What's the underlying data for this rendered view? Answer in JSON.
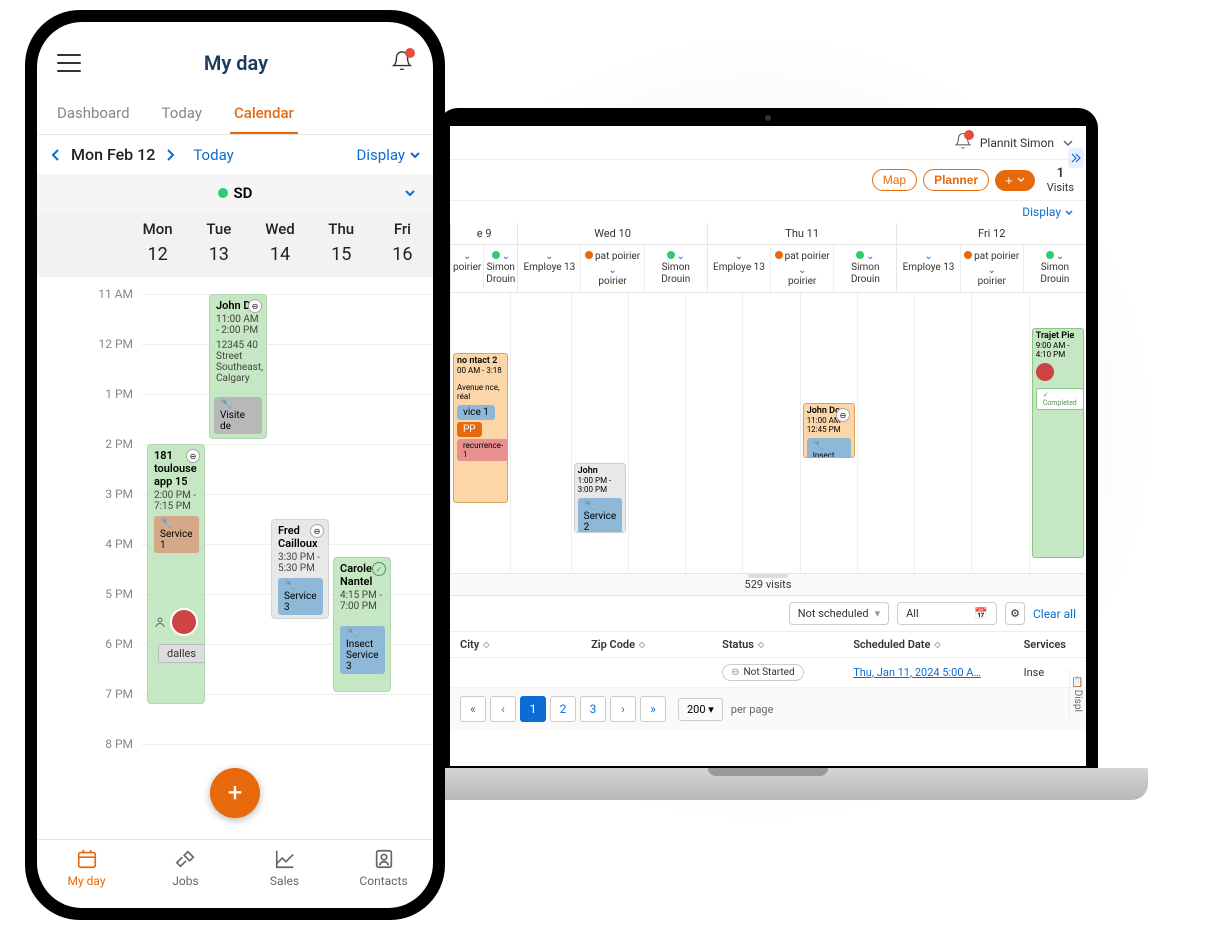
{
  "phone": {
    "title": "My day",
    "tabs": {
      "dashboard": "Dashboard",
      "today": "Today",
      "calendar": "Calendar"
    },
    "date": "Mon Feb 12",
    "today_link": "Today",
    "display_link": "Display",
    "employee_label": "SD",
    "weekdays": [
      {
        "dow": "Mon",
        "num": "12"
      },
      {
        "dow": "Tue",
        "num": "13"
      },
      {
        "dow": "Wed",
        "num": "14"
      },
      {
        "dow": "Thu",
        "num": "15"
      },
      {
        "dow": "Fri",
        "num": "16"
      }
    ],
    "hours": [
      "11 AM",
      "12 PM",
      "1 PM",
      "2 PM",
      "3 PM",
      "4 PM",
      "5 PM",
      "6 PM",
      "7 PM",
      "8 PM"
    ],
    "events": {
      "johndoe": {
        "title": "John Do",
        "time": "11:00 AM - 2:00 PM",
        "loc1": "12345 40 Street",
        "loc2": "Southeast, Calgary",
        "svc": "Visite de"
      },
      "toulouse": {
        "title": "181 toulouse app 15",
        "time": "2:00 PM - 7:15 PM",
        "svc": "Service 1",
        "tag": "dalles"
      },
      "fred": {
        "title": "Fred Cailloux",
        "time": "3:30 PM - 5:30 PM",
        "svc": "Service 3"
      },
      "carole": {
        "title": "Carole Nantel",
        "time": "4:15 PM - 7:00 PM",
        "svc1": "Insect",
        "svc2": "Service 3"
      }
    },
    "bottom_nav": {
      "myday": "My day",
      "jobs": "Jobs",
      "sales": "Sales",
      "contacts": "Contacts"
    }
  },
  "laptop": {
    "user": "Plannit Simon",
    "map_btn": "Map",
    "planner_btn": "Planner",
    "visits_num": "1",
    "visits_lbl": "Visits",
    "display_link": "Display",
    "days": [
      "e 9",
      "Wed 10",
      "Thu 11",
      "Fri 12"
    ],
    "employees": {
      "poirier": "poirier",
      "simon": "Simon Drouin",
      "emp13": "Employe 13",
      "pat": "pat poirier"
    },
    "events": {
      "contact2": {
        "t": "no ntact 2",
        "tm": "00 AM - 3:18",
        "loc": "Avenue nce, réal",
        "svc": "vice 1",
        "rec": "recurrence-1",
        "pp": "PP"
      },
      "john_wed": {
        "t": "John",
        "tm": "1:00 PM - 3:00 PM",
        "svc": "Service 2"
      },
      "john_thu": {
        "t": "John Doe",
        "tm": "11:00 AM - 12:45 PM",
        "svc": "Insect"
      },
      "trajet": {
        "t": "Trajet Pie",
        "tm": "9:00 AM - 4:10 PM",
        "status": "Completed"
      }
    },
    "visits_count": "529 visits",
    "filter_status": "Not scheduled",
    "filter_all": "All",
    "clear_all": "Clear all",
    "columns": {
      "city": "City",
      "zip": "Zip Code",
      "status": "Status",
      "sched": "Scheduled Date",
      "svc": "Services"
    },
    "row1": {
      "status": "Not Started",
      "date": "Thu, Jan 11, 2024 5:00 A…",
      "svc": "Inse"
    },
    "pager": {
      "p1": "1",
      "p2": "2",
      "p3": "3",
      "size": "200",
      "per_page": "per page"
    },
    "display_vert": "Displ"
  }
}
